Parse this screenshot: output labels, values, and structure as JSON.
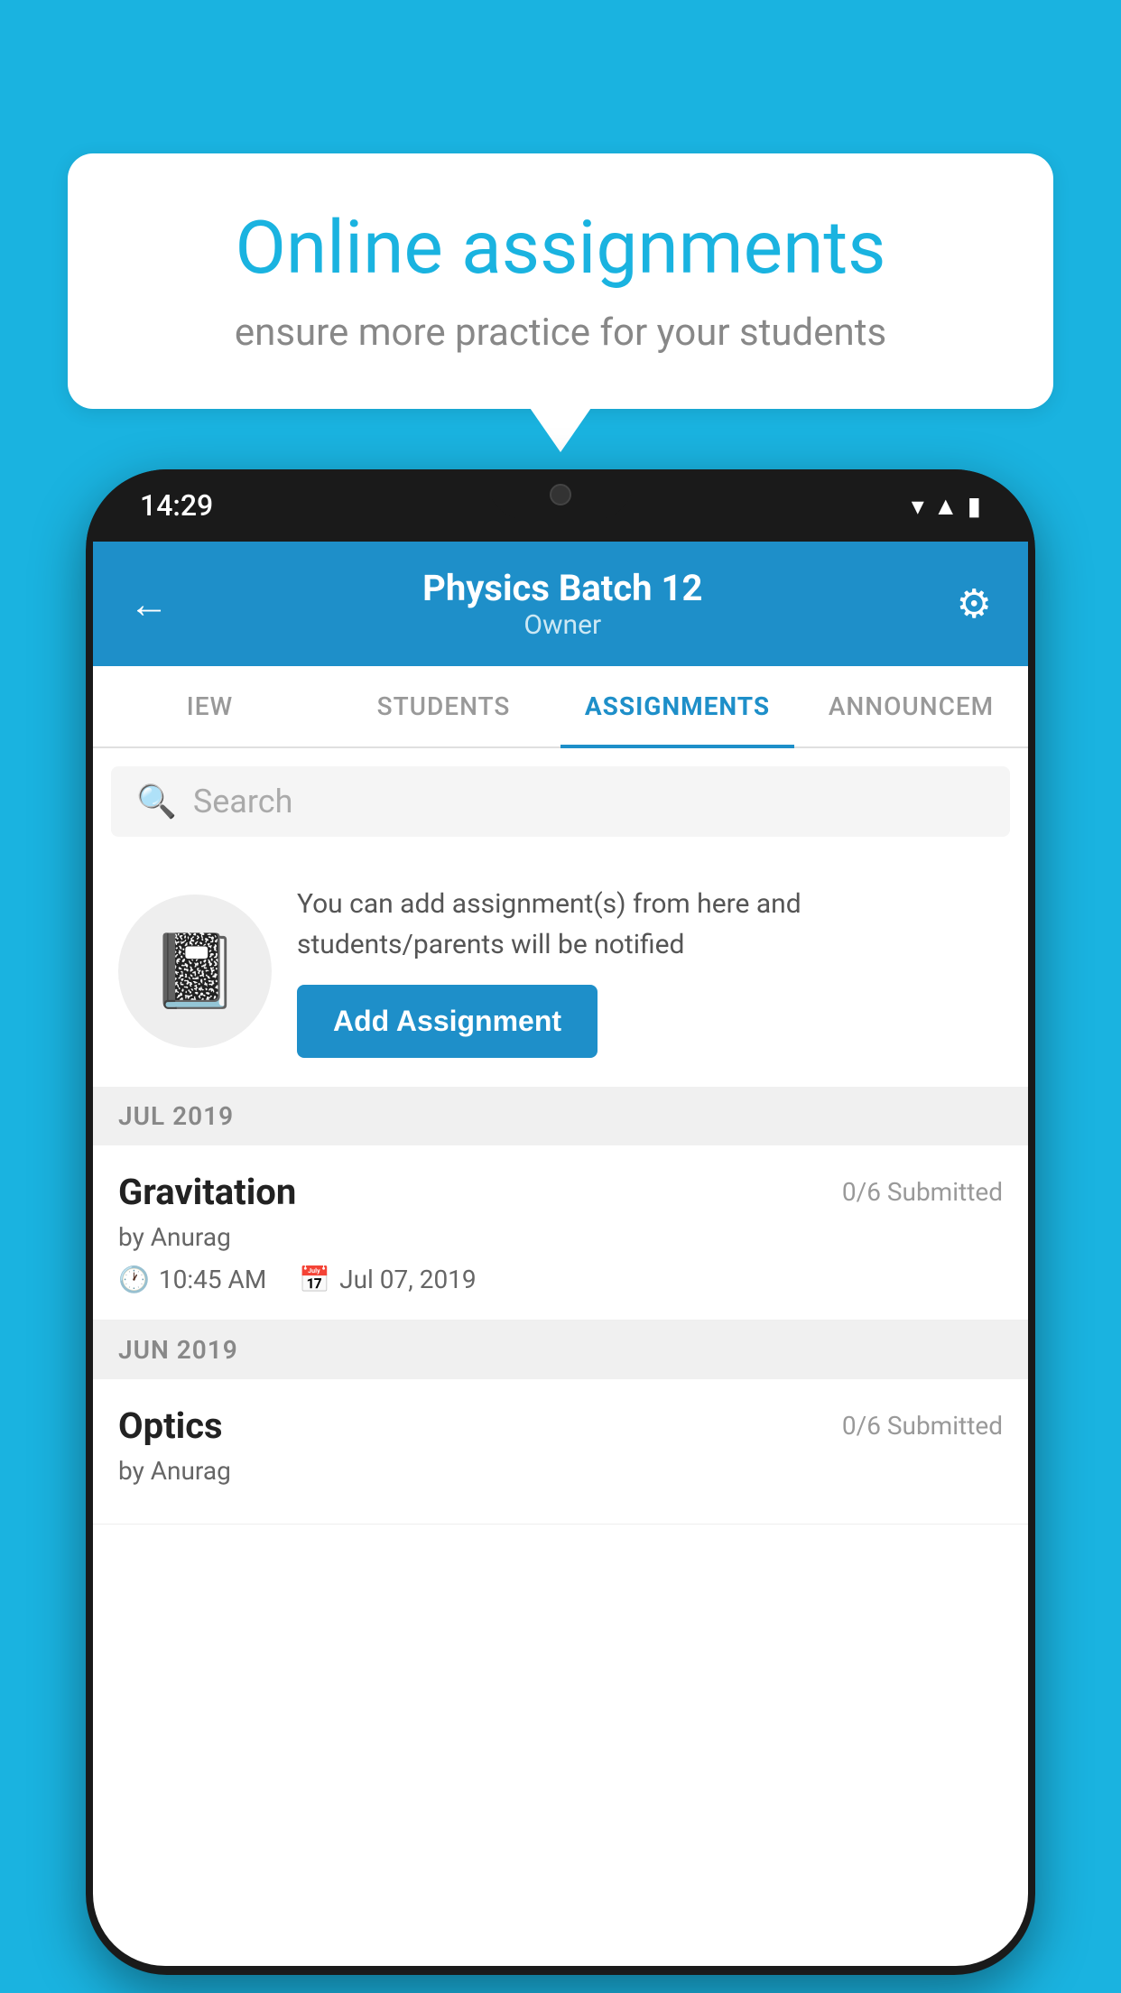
{
  "background_color": "#1ab3e0",
  "speech_bubble": {
    "title": "Online assignments",
    "subtitle": "ensure more practice for your students"
  },
  "phone": {
    "status_bar": {
      "time": "14:29",
      "icons": [
        "wifi",
        "signal",
        "battery"
      ]
    },
    "header": {
      "back_label": "←",
      "title": "Physics Batch 12",
      "subtitle": "Owner",
      "gear_label": "⚙"
    },
    "tabs": [
      {
        "label": "IEW",
        "active": false
      },
      {
        "label": "STUDENTS",
        "active": false
      },
      {
        "label": "ASSIGNMENTS",
        "active": true
      },
      {
        "label": "ANNOUNCEM",
        "active": false
      }
    ],
    "search": {
      "placeholder": "Search"
    },
    "promo": {
      "description": "You can add assignment(s) from here and students/parents will be notified",
      "button_label": "Add Assignment"
    },
    "assignment_sections": [
      {
        "month_label": "JUL 2019",
        "assignments": [
          {
            "name": "Gravitation",
            "submitted": "0/6 Submitted",
            "author": "by Anurag",
            "time": "10:45 AM",
            "date": "Jul 07, 2019"
          }
        ]
      },
      {
        "month_label": "JUN 2019",
        "assignments": [
          {
            "name": "Optics",
            "submitted": "0/6 Submitted",
            "author": "by Anurag",
            "time": "",
            "date": ""
          }
        ]
      }
    ]
  }
}
